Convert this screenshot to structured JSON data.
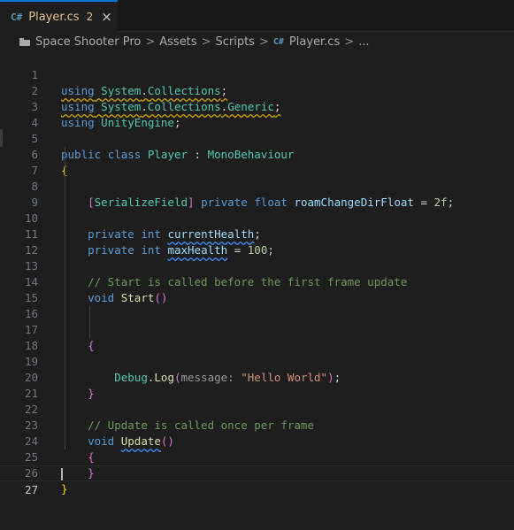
{
  "tab": {
    "language_icon": "C#",
    "file_name": "Player.cs",
    "problem_count": "2",
    "close_icon": "×"
  },
  "breadcrumb": {
    "items": [
      "Space Shooter Pro",
      "Assets",
      "Scripts",
      "Player.cs",
      "..."
    ],
    "separator": ">",
    "file_icon": "C#"
  },
  "editor": {
    "line_numbers": [
      "1",
      "2",
      "3",
      "4",
      "5",
      "6",
      "7",
      "8",
      "9",
      "10",
      "11",
      "12",
      "13",
      "14",
      "15",
      "16",
      "17",
      "18",
      "19",
      "20",
      "21",
      "22",
      "23",
      "24",
      "25",
      "26",
      "27"
    ],
    "current_line": "27",
    "lines": {
      "l1": {
        "kw": "using",
        "ns1": "System",
        "dot": ".",
        "ns2": "Collections",
        "semi": ";"
      },
      "l2": {
        "kw": "using",
        "ns1": "System",
        "dot1": ".",
        "ns2": "Collections",
        "dot2": ".",
        "ns3": "Generic",
        "semi": ";"
      },
      "l3": {
        "kw": "using",
        "ns1": "UnityEngine",
        "semi": ";"
      },
      "l5": {
        "kw1": "public",
        "kw2": "class",
        "name": "Player",
        "colon": ":",
        "base": "MonoBehaviour"
      },
      "l6": {
        "brace": "{"
      },
      "l7": {
        "lb": "[",
        "attr": "SerializeField",
        "rb": "]",
        "kw1": "private",
        "kw2": "float",
        "name": "roamChangeDirFloat",
        "eq": "=",
        "val": "2f",
        "semi": ";"
      },
      "l9": {
        "kw1": "private",
        "kw2": "int",
        "name": "currentHealth",
        "semi": ";"
      },
      "l10": {
        "kw1": "private",
        "kw2": "int",
        "name": "maxHealth",
        "eq": "=",
        "val": "100",
        "semi": ";"
      },
      "l12": {
        "comment": "// Start is called before the first frame update"
      },
      "l13": {
        "kw": "void",
        "name": "Start",
        "parens": "()"
      },
      "l16": {
        "brace": "{"
      },
      "l17": {
        "cls": "Debug",
        "dot": ".",
        "method": "Log",
        "lp": "(",
        "hint": "message:",
        "str": "\"Hello World\"",
        "rp": ")",
        "semi": ";"
      },
      "l19": {
        "brace": "}"
      },
      "l21": {
        "comment": "// Update is called once per frame"
      },
      "l22": {
        "kw": "void",
        "name": "Update",
        "parens": "()"
      },
      "l23": {
        "brace": "{"
      },
      "l24": {
        "brace": "}"
      },
      "l26": {
        "brace": "}"
      }
    }
  },
  "colors": {
    "background": "#1e1e1e",
    "tab_accent": "#0078d4",
    "modified_file": "#e2c08d",
    "csharp_icon": "#519aba",
    "keyword": "#569cd6",
    "type": "#4ec9b0",
    "function": "#dcdcaa",
    "variable": "#9cdcfe",
    "number": "#b5cea8",
    "string": "#ce9178",
    "comment": "#6a9955"
  }
}
